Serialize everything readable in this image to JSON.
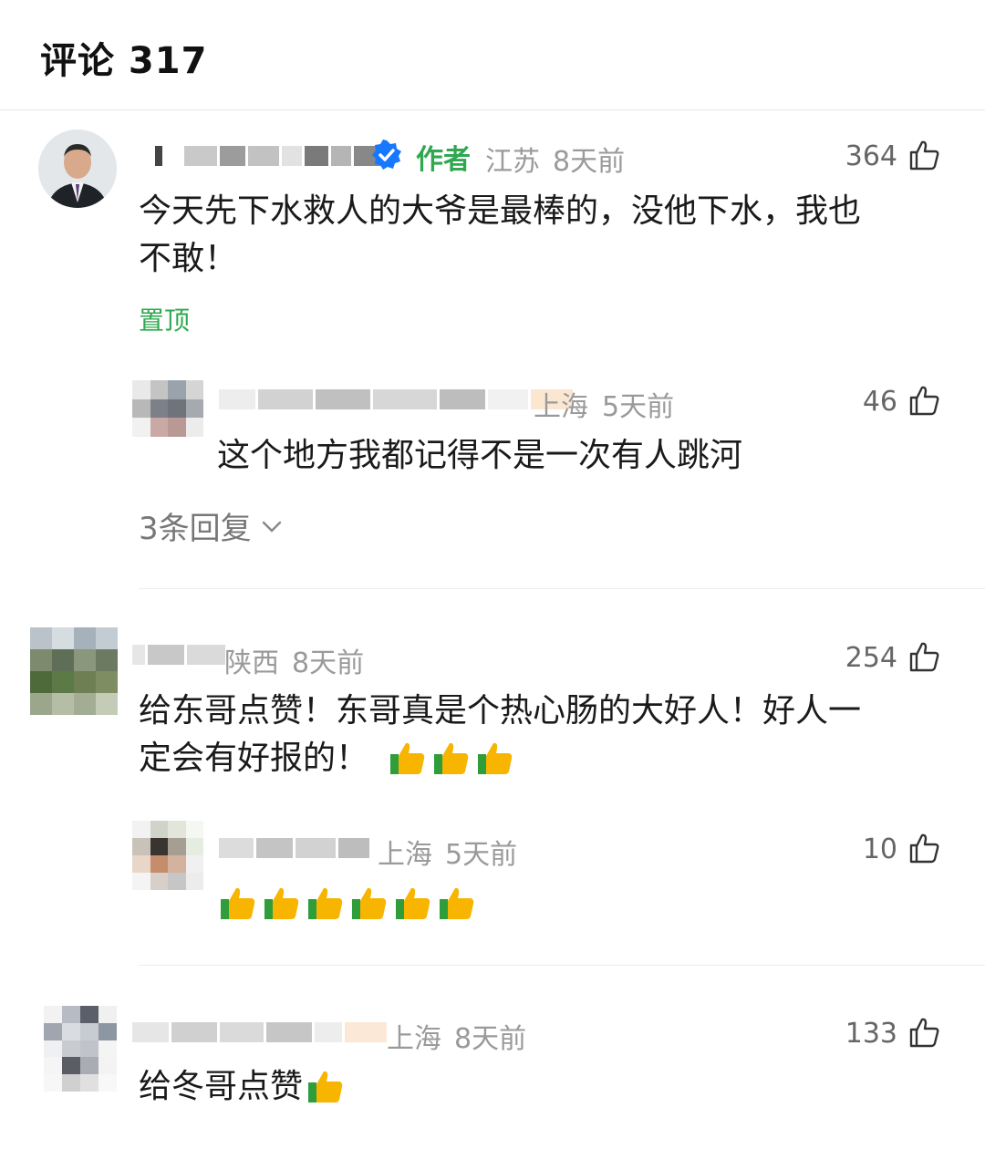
{
  "header": {
    "title": "评论 317"
  },
  "comments": [
    {
      "author_tag": "作者",
      "location": "江苏",
      "time": "8天前",
      "likes": "364",
      "text_line1": "今天先下水救人的大爷是最棒的，没他下水，我也",
      "text_line2": "不敢！",
      "pinned": "置顶",
      "reply": {
        "location": "上海",
        "time": "5天前",
        "likes": "46",
        "text": "这个地方我都记得不是一次有人跳河"
      },
      "replies_link": "3条回复"
    },
    {
      "location": "陕西",
      "time": "8天前",
      "likes": "254",
      "text_line1": "给东哥点赞！东哥真是个热心肠的大好人！好人一",
      "text_line2": "定会有好报的！",
      "emoji_count": 3,
      "reply": {
        "location": "上海",
        "time": "5天前",
        "likes": "10",
        "emoji_count": 6
      }
    },
    {
      "location": "上海",
      "time": "8天前",
      "likes": "133",
      "text": "给冬哥点赞",
      "emoji_count": 1
    }
  ],
  "icons": {
    "like": "thumbs-up-outline-icon",
    "verified": "verified-badge-icon",
    "emoji": "thumbs-up-emoji-icon",
    "chevron": "chevron-down-icon"
  },
  "colors": {
    "accent_green": "#2fa84f",
    "verified_blue": "#1677ff",
    "meta_gray": "#9a9a9a"
  }
}
